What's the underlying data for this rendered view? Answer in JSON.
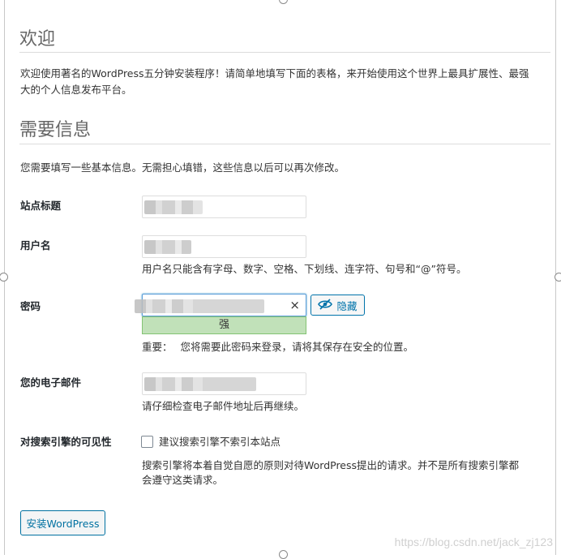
{
  "welcome": {
    "heading": "欢迎",
    "intro_line1": "欢迎使用著名的WordPress五分钟安装程序！请简单地填写下面的表格，来开始使用这个世界上最具扩展性、最强",
    "intro_line2": "大的个人信息发布平台。"
  },
  "info": {
    "heading": "需要信息",
    "description": "您需要填写一些基本信息。无需担心填错，这些信息以后可以再次修改。"
  },
  "form": {
    "site_title": {
      "label": "站点标题"
    },
    "username": {
      "label": "用户名",
      "hint": "用户名只能含有字母、数字、空格、下划线、连字符、句号和“@”符号。"
    },
    "password": {
      "label": "密码",
      "clear_symbol": "×",
      "hide_label": "隐藏",
      "strength": "强",
      "important_prefix": "重要：",
      "important_text": "您将需要此密码来登录，请将其保存在安全的位置。"
    },
    "email": {
      "label": "您的电子邮件",
      "hint": "请仔细检查电子邮件地址后再继续。"
    },
    "search_visibility": {
      "label": "对搜索引擎的可见性",
      "checkbox_label": "建议搜索引擎不索引本站点",
      "note_line1": "搜索引擎将本着自觉自愿的原则对待WordPress提出的请求。并不是所有搜索引擎都",
      "note_line2": "会遵守这类请求。",
      "checked": false
    }
  },
  "install_button": "安装WordPress",
  "watermark": "https://blog.csdn.net/jack_zj123",
  "icons": {
    "hide": "eye-slash-icon",
    "clear": "close-icon"
  },
  "colors": {
    "accent": "#0073aa",
    "strength_bg": "#c1e1b9",
    "strength_border": "#83c373"
  }
}
